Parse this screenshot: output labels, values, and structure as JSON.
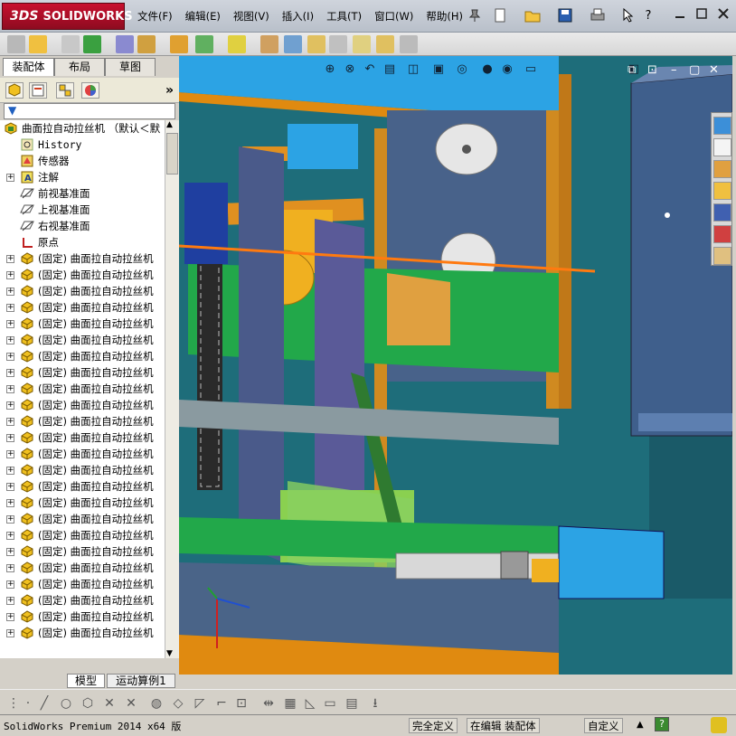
{
  "titlebar": {
    "brand_prefix": "3DS",
    "brand": "SOLIDWORKS",
    "menus": [
      "文件(F)",
      "编辑(E)",
      "视图(V)",
      "插入(I)",
      "工具(T)",
      "窗口(W)",
      "帮助(H)"
    ],
    "help_icon": "?"
  },
  "tabs": [
    {
      "label": "装配体",
      "active": true
    },
    {
      "label": "布局",
      "active": false
    },
    {
      "label": "草图",
      "active": false
    }
  ],
  "tree": {
    "root": "曲面拉自动拉丝机 （默认＜默",
    "items": [
      {
        "label": "History",
        "icon": "history-icon",
        "expand": false
      },
      {
        "label": "传感器",
        "icon": "sensor-icon",
        "expand": false
      },
      {
        "label": "注解",
        "icon": "annotation-icon",
        "expand": true
      },
      {
        "label": "前视基准面",
        "icon": "plane-icon",
        "expand": false
      },
      {
        "label": "上视基准面",
        "icon": "plane-icon",
        "expand": false
      },
      {
        "label": "右视基准面",
        "icon": "plane-icon",
        "expand": false
      },
      {
        "label": "原点",
        "icon": "origin-icon",
        "expand": false
      }
    ],
    "fixed_component": "(固定) 曲面拉自动拉丝机",
    "fixed_count": 24
  },
  "bottom_tabs": [
    "模型",
    "运动算例1"
  ],
  "status": {
    "app": "SolidWorks Premium 2014 x64 版",
    "defined": "完全定义",
    "editing": "在编辑 装配体",
    "custom": "自定义"
  },
  "colors": {
    "viewport_bg": "#1e6d7a",
    "frame_orange": "#e08a10",
    "accent_blue": "#2ca3e4",
    "panel_gray": "#4a6488",
    "green_plate": "#22a84a"
  }
}
